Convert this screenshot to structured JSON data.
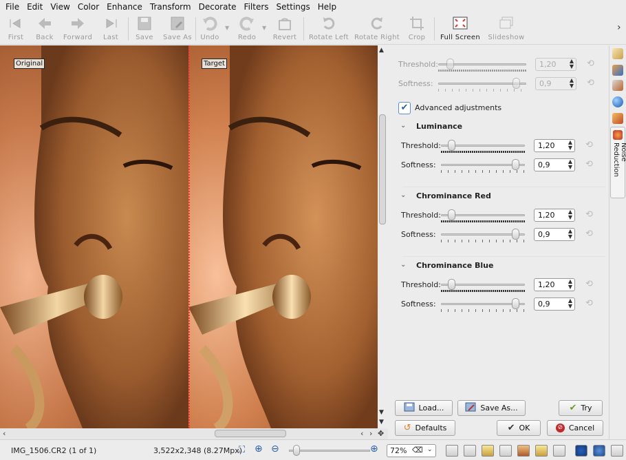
{
  "menu": [
    "File",
    "Edit",
    "View",
    "Color",
    "Enhance",
    "Transform",
    "Decorate",
    "Filters",
    "Settings",
    "Help"
  ],
  "toolbar": {
    "first": "First",
    "back": "Back",
    "forward": "Forward",
    "last": "Last",
    "save": "Save",
    "save_as": "Save As",
    "undo": "Undo",
    "redo": "Redo",
    "revert": "Revert",
    "rotate_left": "Rotate Left",
    "rotate_right": "Rotate Right",
    "crop": "Crop",
    "full_screen": "Full Screen",
    "slideshow": "Slideshow",
    "more": "›"
  },
  "preview": {
    "original_label": "Original",
    "target_label": "Target"
  },
  "panel": {
    "top_threshold_label": "Threshold:",
    "top_threshold_value": "1,20",
    "top_softness_label": "Softness:",
    "top_softness_value": "0,9",
    "advanced_label": "Advanced adjustments",
    "advanced_checked": true,
    "sections": [
      {
        "title": "Luminance",
        "threshold_label": "Threshold:",
        "threshold_value": "1,20",
        "softness_label": "Softness:",
        "softness_value": "0,9"
      },
      {
        "title": "Chrominance Red",
        "threshold_label": "Threshold:",
        "threshold_value": "1,20",
        "softness_label": "Softness:",
        "softness_value": "0,9"
      },
      {
        "title": "Chrominance Blue",
        "threshold_label": "Threshold:",
        "threshold_value": "1,20",
        "softness_label": "Softness:",
        "softness_value": "0,9"
      }
    ],
    "threshold_level": 0.12,
    "softness_level": 0.9,
    "buttons": {
      "load": "Load...",
      "save_as": "Save As...",
      "try": "Try",
      "defaults": "Defaults",
      "ok": "OK",
      "cancel": "Cancel"
    }
  },
  "sidebar": {
    "noise_reduction_tab": "Noise Reduction"
  },
  "status": {
    "filename": "IMG_1506.CR2 (1 of 1)",
    "dimensions": "3,522x2,348 (8.27Mpx)",
    "zoom": "72%",
    "zoom_level": 0.72
  },
  "colors": {
    "accent": "#2b5fa6",
    "divider": "#ff3030",
    "cancel_red": "#c0282a",
    "ok_green": "#3a7a2a"
  }
}
